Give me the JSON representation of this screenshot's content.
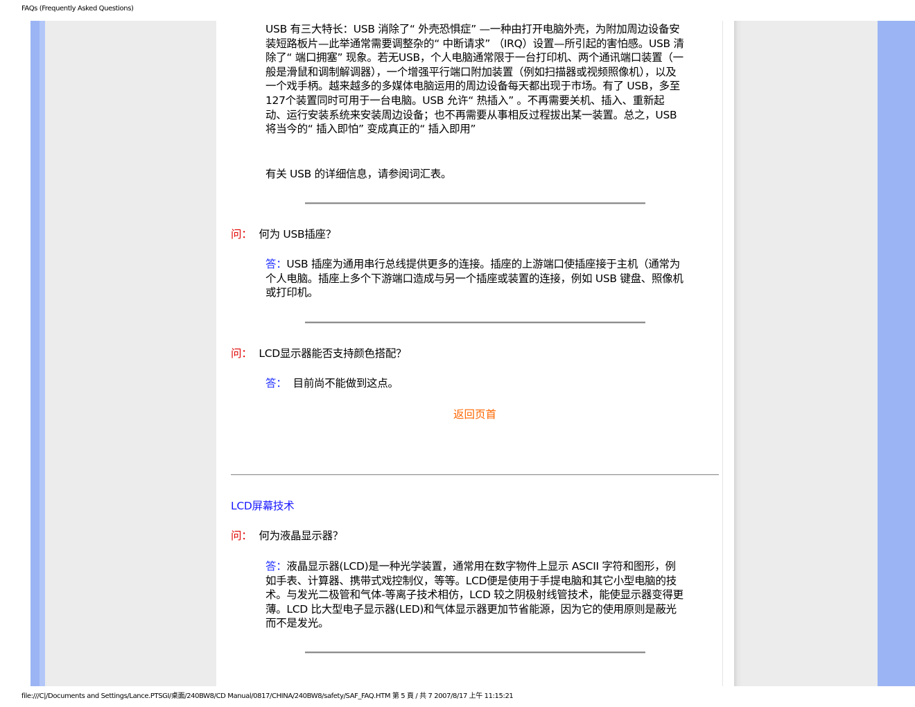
{
  "header": {
    "title": "FAQs (Frequently Asked Questions)"
  },
  "footer": {
    "path": "file:///C|/Documents and Settings/Lance.PTSGI/桌面/240BW8/CD Manual/0817/CHINA/240BW8/safety/SAF_FAQ.HTM 第 5 頁 / 共 7 2007/8/17 上午 11:15:21"
  },
  "colors": {
    "question_label": "#e00000",
    "answer_label": "#2232ff",
    "back_link": "#ff6600",
    "section_title": "#1a1aff",
    "side_bar_blue": "#9bb4f4",
    "side_panel_grey": "#ececec"
  },
  "content": {
    "usb_features_text": "USB 有三大特长：USB 消除了“ 外壳恐惧症” —一种由打开电脑外壳，为附加周边设备安装短路板片—此举通常需要调整杂的“ 中断请求” （IRQ）设置—所引起的害怕感。USB 清除了“ 端口拥塞” 现象。若无USB，个人电脑通常限于一台打印机、两个通讯端口装置（一般是滑鼠和调制解调器），一个增强平行端口附加装置（例如扫描器或视频照像机），以及一个戏手柄。越来越多的多媒体电脑运用的周边设备每天都出现于市场。有了 USB，多至 127个装置同时可用于一台电脑。USB 允许“ 热插入” 。不再需要关机、插入、重新起动、运行安装系统来安装周边设备；也不再需要从事相反过程拔出某一装置。总之，USB 将当今的“ 插入即怕” 变成真正的“ 插入即用”",
    "usb_more_info": "有关  USB 的详细信息，请参阅词汇表。",
    "faqs": [
      {
        "q_label": "问：",
        "question": "何为  USB插座？",
        "a_label": "答：",
        "answer": "USB 插座为通用串行总线提供更多的连接。插座的上游端口使插座接于主机（通常为个人电脑。插座上多个下游端口造成与另一个插座或装置的连接，例如  USB 键盘、照像机或打印机。"
      },
      {
        "q_label": "问：",
        "question": "LCD显示器能否支持颜色搭配？",
        "a_label": "答：",
        "answer": "  目前尚不能做到这点。"
      }
    ],
    "back_to_top": "返回页首",
    "section_title": "LCD屏幕技术",
    "lcd_faq": {
      "q_label": "问：",
      "question": "何为液晶显示器？",
      "a_label": "答：",
      "answer": "液晶显示器(LCD)是一种光学装置，通常用在数字物件上显示  ASCII  字符和图形，例如手表、计算器、携带式戏控制仪，等等。LCD便是使用于手提电脑和其它小型电脑的技术。与发光二极管和气体-等离子技术相仿，LCD 较之阴极射线管技术，能使显示器变得更薄。LCD 比大型电子显示器(LED)和气体显示器更加节省能源，因为它的使用原则是蔽光而不是发光。"
    }
  }
}
